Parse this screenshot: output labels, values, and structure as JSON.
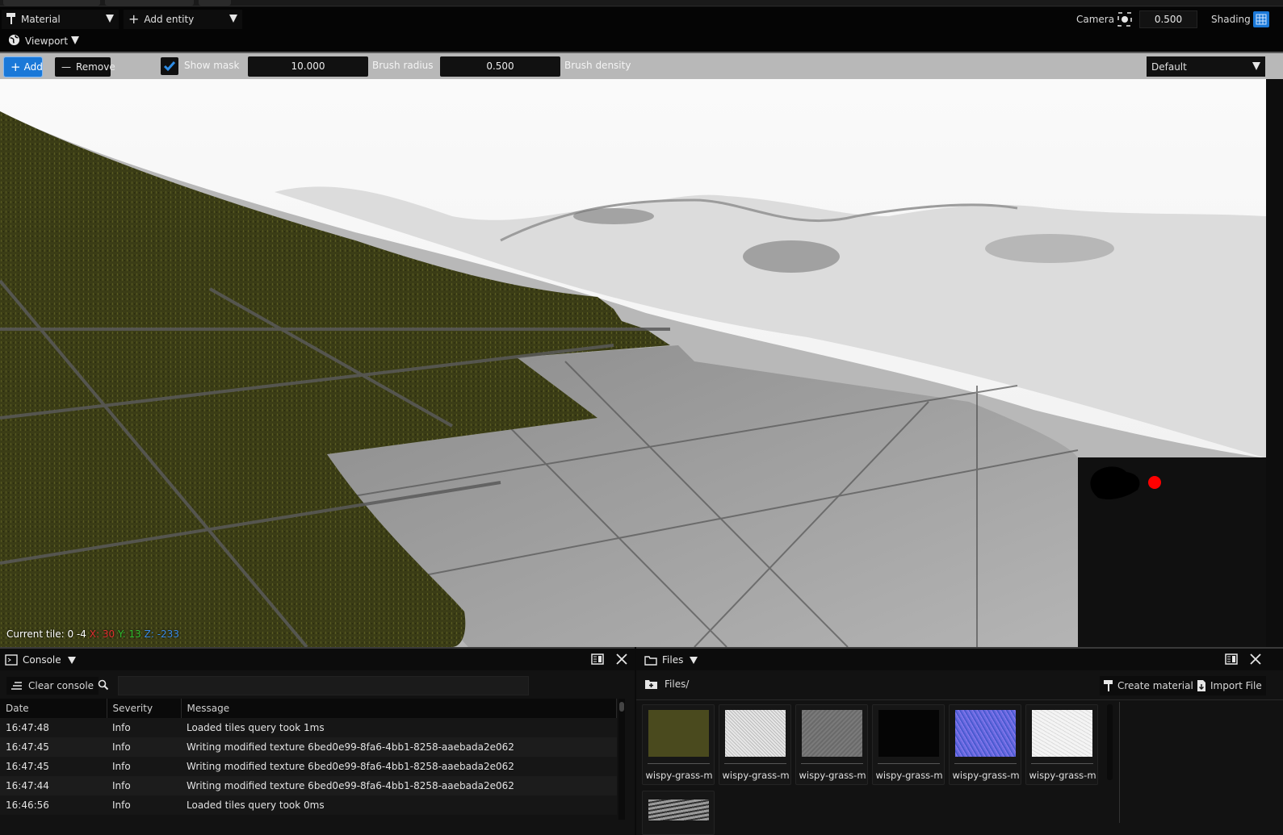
{
  "toolbar_top": {
    "material_label": "Material",
    "add_entity_label": "Add entity",
    "camera_label": "Camera",
    "camera_value": "0.500",
    "shading_label": "Shading",
    "viewport_label": "Viewport"
  },
  "brush_toolbar": {
    "add_label": "Add",
    "remove_label": "Remove",
    "show_mask_label": "Show mask",
    "show_mask_checked": true,
    "brush_radius_value": "10.000",
    "brush_radius_label": "Brush radius",
    "brush_density_value": "0.500",
    "brush_density_label": "Brush density",
    "preset_value": "Default"
  },
  "viewport": {
    "current_tile_label": "Current tile: 0 -4",
    "x_coord": "X: 30",
    "y_coord": "Y: 13",
    "z_coord": "Z: -233"
  },
  "console": {
    "tab_label": "Console",
    "clear_label": "Clear console",
    "search_placeholder": "",
    "columns": [
      "Date",
      "Severity",
      "Message"
    ],
    "rows": [
      {
        "date": "16:47:48",
        "severity": "Info",
        "message": "Loaded tiles query took 1ms"
      },
      {
        "date": "16:47:45",
        "severity": "Info",
        "message": "Writing modified texture 6bed0e99-8fa6-4bb1-8258-aaebada2e062"
      },
      {
        "date": "16:47:45",
        "severity": "Info",
        "message": "Writing modified texture 6bed0e99-8fa6-4bb1-8258-aaebada2e062"
      },
      {
        "date": "16:47:44",
        "severity": "Info",
        "message": "Writing modified texture 6bed0e99-8fa6-4bb1-8258-aaebada2e062"
      },
      {
        "date": "16:46:56",
        "severity": "Info",
        "message": "Loaded tiles query took 0ms"
      }
    ]
  },
  "files": {
    "tab_label": "Files",
    "path": "Files/",
    "create_material_label": "Create material",
    "import_file_label": "Import File",
    "items": [
      {
        "name": "wispy-grass-m",
        "swatch": "#4a4a1e"
      },
      {
        "name": "wispy-grass-m",
        "swatch": "#d8d8d8"
      },
      {
        "name": "wispy-grass-m",
        "swatch": "#6a6a6a"
      },
      {
        "name": "wispy-grass-m",
        "swatch": "#050505"
      },
      {
        "name": "wispy-grass-m",
        "swatch": "#6a6ae0"
      },
      {
        "name": "wispy-grass-m",
        "swatch": "#f4f4f4"
      }
    ]
  },
  "colors": {
    "accent": "#1a78d8",
    "x_axis": "#e03030",
    "y_axis": "#30c030",
    "z_axis": "#3a8ae6",
    "brush_marker": "#ff0000"
  }
}
